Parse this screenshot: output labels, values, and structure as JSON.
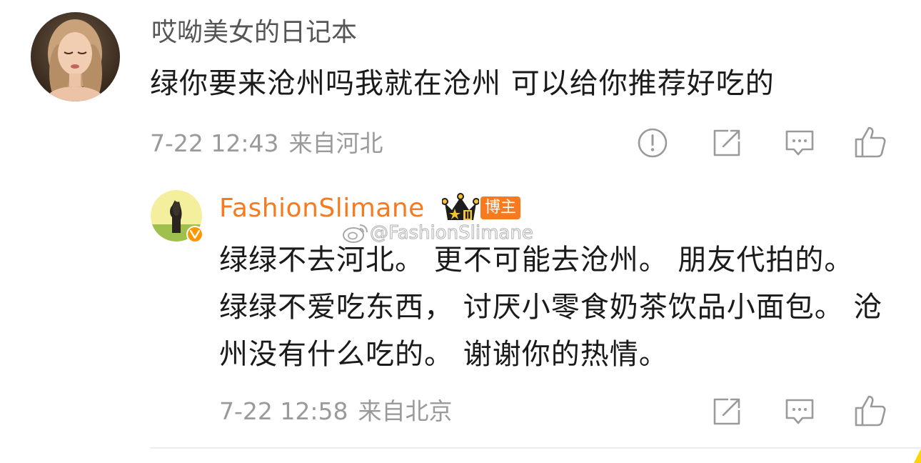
{
  "colors": {
    "top_username": "#555555",
    "reply_username": "#f77a1f",
    "meta": "#9a9a9a",
    "icon": "#9a9a9a",
    "badge": "#f77a1f"
  },
  "top_comment": {
    "username": "哎呦美女的日记本",
    "text": "绿你要来沧州吗我就在沧州 可以给你推荐好吃的",
    "date": "7-22 12:43",
    "location": "来自河北",
    "actions": [
      "report-icon",
      "forward-icon",
      "comment-icon",
      "like-icon"
    ]
  },
  "reply": {
    "username": "FashionSlimane",
    "role_badge": "博主",
    "level_badge_icon": "crown-level-icon",
    "verified_icon": "verified-v-icon",
    "text": "绿绿不去河北。 更不可能去沧州。 朋友代拍的。 绿绿不爱吃东西， 讨厌小零食奶茶饮品小面包。 沧州没有什么吃的。 谢谢你的热情。",
    "date": "7-22 12:58",
    "location": "来自北京",
    "actions": [
      "forward-icon",
      "comment-icon",
      "like-icon"
    ]
  },
  "watermark": {
    "text": "@FashionSlimane",
    "icon": "weibo-logo-icon"
  }
}
